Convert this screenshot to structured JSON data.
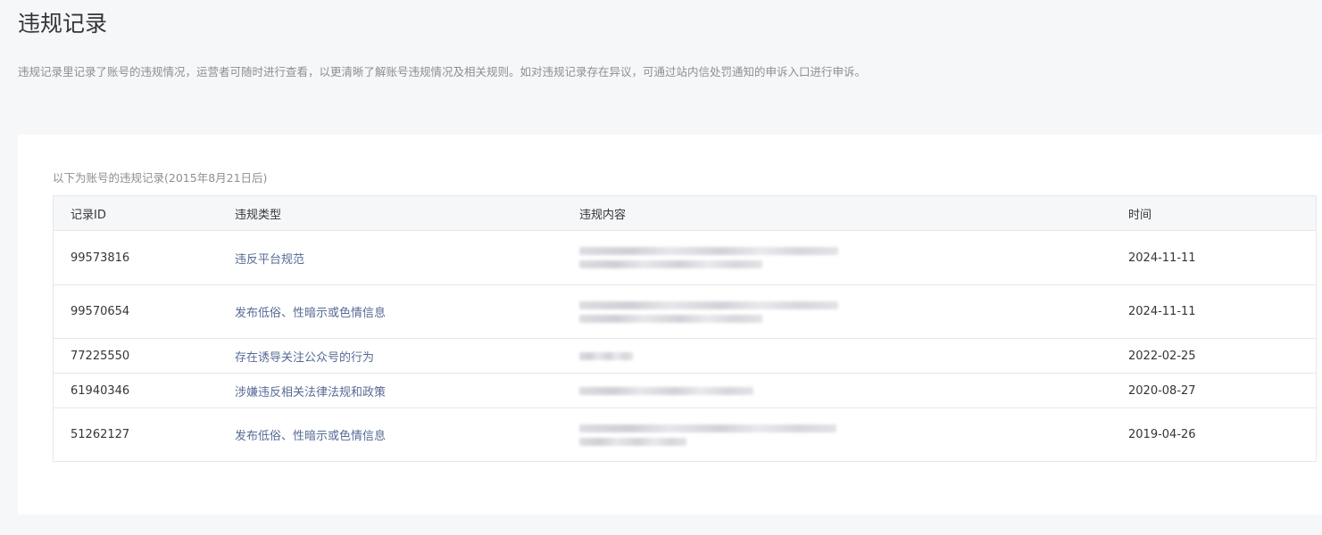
{
  "page": {
    "title": "违规记录",
    "description": "违规记录里记录了账号的违规情况，运营者可随时进行查看，以更清晰了解账号违规情况及相关规则。如对违规记录存在异议，可通过站内信处罚通知的申诉入口进行申诉。"
  },
  "table": {
    "caption": "以下为账号的违规记录(2015年8月21日后)",
    "headers": {
      "id": "记录ID",
      "type": "违规类型",
      "content": "违规内容",
      "time": "时间"
    },
    "rows": [
      {
        "id": "99573816",
        "type": "违反平台规范",
        "time": "2024-11-11"
      },
      {
        "id": "99570654",
        "type": "发布低俗、性暗示或色情信息",
        "time": "2024-11-11"
      },
      {
        "id": "77225550",
        "type": "存在诱导关注公众号的行为",
        "time": "2022-02-25"
      },
      {
        "id": "61940346",
        "type": "涉嫌违反相关法律法规和政策",
        "time": "2020-08-27"
      },
      {
        "id": "51262127",
        "type": "发布低俗、性暗示或色情信息",
        "time": "2019-04-26"
      }
    ]
  }
}
